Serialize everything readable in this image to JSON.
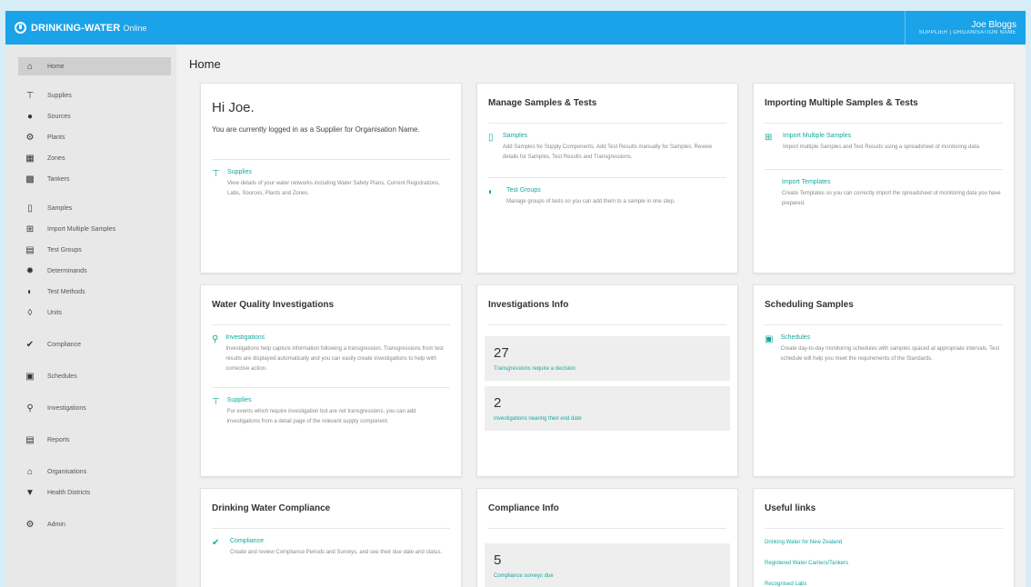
{
  "header": {
    "brand": "DRINKING-WATER",
    "brand_suffix": "Online",
    "user_name": "Joe Bloggs",
    "user_role": "SUPPLIER | ORGANISATION NAME"
  },
  "sidebar": {
    "items": [
      {
        "label": "Home",
        "icon": "home-icon"
      },
      {
        "label": "Supplies",
        "icon": "tap-icon"
      },
      {
        "label": "Sources",
        "icon": "drop-icon"
      },
      {
        "label": "Plants",
        "icon": "plant-icon"
      },
      {
        "label": "Zones",
        "icon": "zones-icon"
      },
      {
        "label": "Tankers",
        "icon": "truck-icon"
      },
      {
        "label": "Samples",
        "icon": "sample-bottle-icon"
      },
      {
        "label": "Import Multiple Samples",
        "icon": "import-icon"
      },
      {
        "label": "Test Groups",
        "icon": "test-groups-icon"
      },
      {
        "label": "Determinands",
        "icon": "determinands-icon"
      },
      {
        "label": "Test Methods",
        "icon": "test-methods-icon"
      },
      {
        "label": "Units",
        "icon": "tag-icon"
      },
      {
        "label": "Compliance",
        "icon": "check-circle-icon"
      },
      {
        "label": "Schedules",
        "icon": "calendar-icon"
      },
      {
        "label": "Investigations",
        "icon": "search-icon"
      },
      {
        "label": "Reports",
        "icon": "reports-icon"
      },
      {
        "label": "Organisations",
        "icon": "building-icon"
      },
      {
        "label": "Health Districts",
        "icon": "location-pin-icon"
      },
      {
        "label": "Admin",
        "icon": "gear-icon"
      }
    ]
  },
  "main": {
    "title": "Home",
    "welcome": {
      "greeting": "Hi Joe.",
      "subtext": "You are currently logged in as a Supplier for Organisation Name.",
      "link_title": "Supplies",
      "link_desc": "View details of your water networks including Water Safety Plans, Current Registrations, Labs, Sources, Plants and Zones."
    },
    "manage": {
      "title": "Manage Samples & Tests",
      "samples_title": "Samples",
      "samples_desc": "Add Samples for Supply Components. Add Test Results manually for Samples. Review details for Samples, Test Results and Transgressions.",
      "testgroups_title": "Test Groups",
      "testgroups_desc": "Manage groups of tests so you can add them to a sample in one step."
    },
    "importing": {
      "title": "Importing Multiple Samples & Tests",
      "import_title": "Import Multiple Samples",
      "import_desc": "Import multiple Samples and Test Results using a spreadsheet of monitoring data.",
      "templates_title": "Import Templates",
      "templates_desc": "Create Templates so you can correctly import the spreadsheet of monitoring data you have prepared."
    },
    "wqi": {
      "title": "Water Quality Investigations",
      "inv_title": "Investigations",
      "inv_desc": "Investigations help capture information following a transgression. Transgressions from test results are displayed automatically and you can easily create investigations to help with corrective action.",
      "sup_title": "Supplies",
      "sup_desc": "For events which require investigation but are not transgressions, you can add investigations from a detail page of the relevant supply component."
    },
    "inv_info": {
      "title": "Investigations Info",
      "stat1_num": "27",
      "stat1_label": "Transgressions require a decision",
      "stat2_num": "2",
      "stat2_label": "Investigations nearing their end date"
    },
    "scheduling": {
      "title": "Scheduling Samples",
      "sched_title": "Schedules",
      "sched_desc": "Create day-to-day monitoring schedules with samples spaced at appropriate intervals. Test schedule will help you meet the requirements of the Standards."
    },
    "dwc": {
      "title": "Drinking Water Compliance",
      "comp_title": "Compliance",
      "comp_desc": "Create and review Compliance Periods and Surveys, and see their due date and status."
    },
    "comp_info": {
      "title": "Compliance Info",
      "stat_num": "5",
      "stat_label": "Compliance surveys due"
    },
    "useful": {
      "title": "Useful links",
      "links": [
        "Drinking Water for New Zealand",
        "Registered Water Carriers/Tankers",
        "Recognised Labs"
      ]
    }
  },
  "colors": {
    "topbar": "#1aa3e8",
    "accent": "#13a89e",
    "sidebar": "#e8e8e8",
    "main_bg": "#f1f1f1"
  }
}
